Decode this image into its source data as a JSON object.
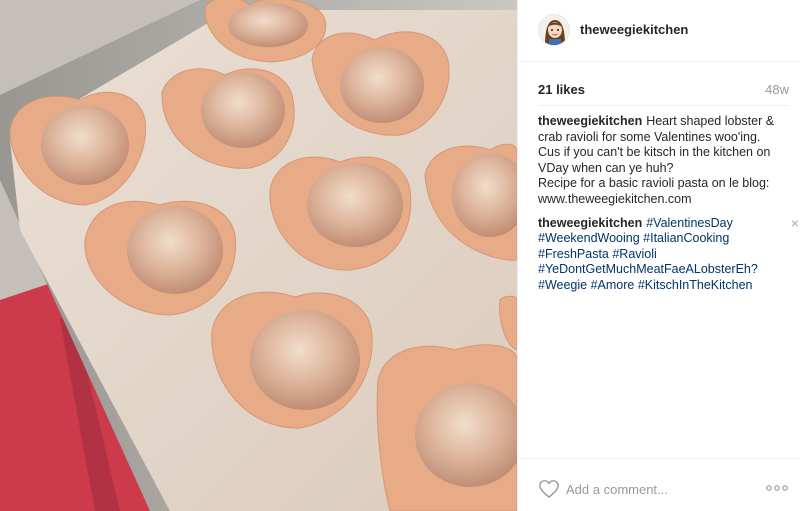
{
  "post": {
    "username": "theweegiekitchen",
    "likes": "21 likes",
    "age": "48w"
  },
  "caption": {
    "author": "theweegiekitchen",
    "lines": [
      "Heart shaped lobster &",
      "crab ravioli for some Valentines woo'ing.",
      "Cus if you can't be kitsch in the kitchen on",
      "VDay when can ye huh?",
      "Recipe for a basic ravioli pasta on le blog:",
      "www.theweegiekitchen.com"
    ]
  },
  "hashtag_comment": {
    "author": "theweegiekitchen",
    "lines": [
      "#ValentinesDay",
      "#WeekendWooing #ItalianCooking",
      "#FreshPasta #Ravioli",
      "#YeDontGetMuchMeatFaeALobsterEh?",
      "#Weegie #Amore #KitschInTheKitchen"
    ],
    "delete_label": "×"
  },
  "composer": {
    "placeholder": "Add a comment...",
    "like_icon": "heart-outline-icon",
    "more_icon": "ellipsis-icon"
  },
  "colors": {
    "hashtag": "#003569",
    "muted": "#999999",
    "text": "#262626",
    "divider": "#efefef"
  }
}
